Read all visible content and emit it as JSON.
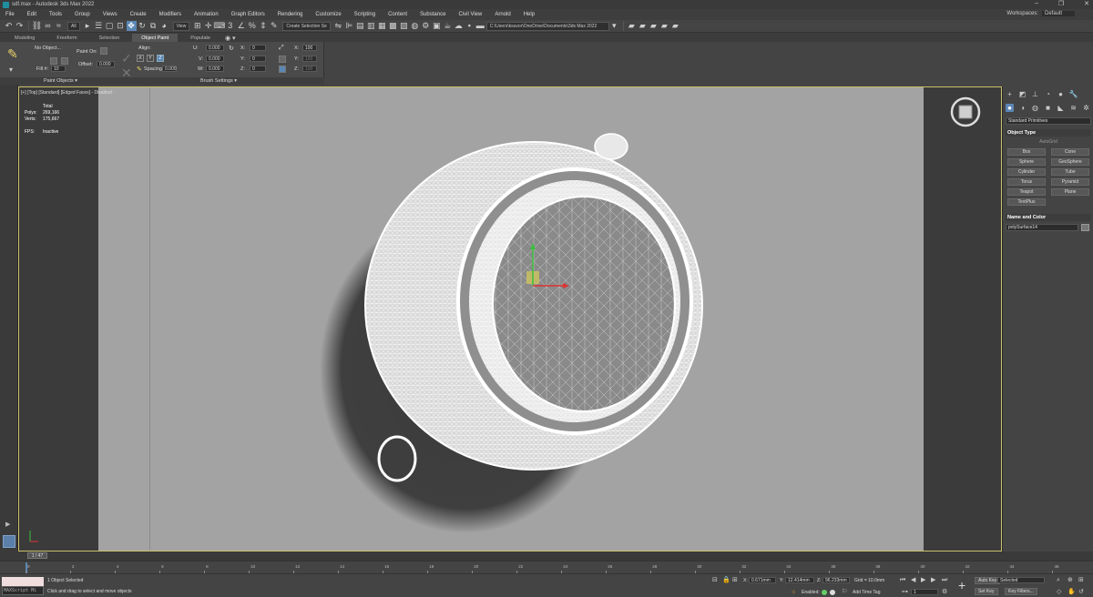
{
  "window": {
    "title": "sdf.max - Autodesk 3ds Max 2022",
    "controls": [
      "–",
      "❐",
      "✕"
    ]
  },
  "menu": {
    "items": [
      "File",
      "Edit",
      "Tools",
      "Group",
      "Views",
      "Create",
      "Modifiers",
      "Animation",
      "Graph Editors",
      "Rendering",
      "Customize",
      "Scripting",
      "Content",
      "Substance",
      "Civil View",
      "Arnold",
      "Help"
    ],
    "workspaces_label": "Workspaces:",
    "workspaces_value": "Default"
  },
  "toolbar": {
    "selection_filter": "All",
    "view_dropdown": "View",
    "named_selection": "Create Selection Se",
    "project_path": "C:\\Users\\ksuvor\\OneDrive\\Documents\\3ds Max 2022"
  },
  "ribbon": {
    "tabs": [
      "Modeling",
      "Freeform",
      "Selection",
      "Object Paint",
      "Populate"
    ],
    "active_tab": "Object Paint",
    "extra": "◉ ▾",
    "no_object": "No Object...",
    "fill_label": "Fill #:",
    "fill_value": "10",
    "paint_on_label": "Paint On:",
    "offset_label": "Offset:",
    "offset_value": "0.000",
    "align_label": "Align:",
    "axis_x": "X",
    "axis_y": "Y",
    "axis_z": "Z",
    "spacing_label": "Spacing:",
    "spacing_value": "0.000",
    "u_label": "U:",
    "v_label": "V:",
    "w_label": "W:",
    "uvw_value": "0.000",
    "rx_label": "X:",
    "ry_label": "Y:",
    "rz_label": "Z:",
    "rot_value": "0",
    "sx_label": "X:",
    "sy_label": "Y:",
    "sz_label": "Z:",
    "scale_x_value": "100",
    "scale_yz_value": "100",
    "footer_left": "Paint Objects ▾",
    "footer_right": "Brush Settings ▾"
  },
  "viewport": {
    "label": "[+] [Top] [Standard] [Edged Faces] - Disabled -",
    "stats": {
      "total_label": "Total",
      "polys_label": "Polys:",
      "polys_value": "269,166",
      "verts_label": "Verts:",
      "verts_value": "175,667",
      "fps_label": "FPS:",
      "fps_value": "Inactive"
    }
  },
  "command_panel": {
    "category": "Standard Primitives",
    "object_type_title": "Object Type",
    "autogrid": "AutoGrid",
    "buttons": [
      "Box",
      "Cone",
      "Sphere",
      "GeoSphere",
      "Cylinder",
      "Tube",
      "Torus",
      "Pyramid",
      "Teapot",
      "Plane",
      "TextPlus"
    ],
    "name_color_title": "Name and Color",
    "object_name": "polySurface14"
  },
  "timeline": {
    "frame_display": "1 / 47",
    "ticks": [
      0,
      2,
      4,
      6,
      8,
      10,
      12,
      14,
      16,
      18,
      20,
      22,
      24,
      26,
      28,
      30,
      32,
      34,
      36,
      38,
      40,
      42,
      44,
      46
    ]
  },
  "status": {
    "maxscript_label": "MAXScript Mi",
    "selected": "1 Object Selected",
    "prompt": "Click and drag to select and move objects",
    "x_label": "X:",
    "x_value": "0.671mm",
    "y_label": "Y:",
    "y_value": "12.414mm",
    "z_label": "Z:",
    "z_value": "96.233mm",
    "grid": "Grid = 10.0mm",
    "enabled": "Enabled:",
    "add_time_tag": "Add Time Tag",
    "auto_key": "Auto Key",
    "selected_dd": "Selected",
    "set_key": "Set Key",
    "key_filters": "Key Filters...",
    "frame_value": "1"
  }
}
